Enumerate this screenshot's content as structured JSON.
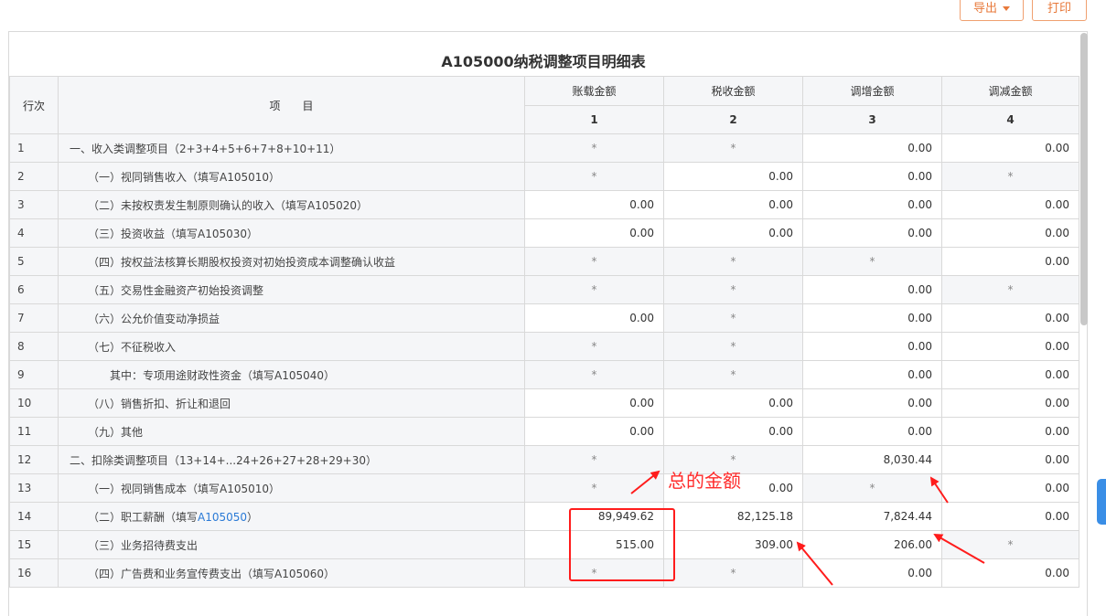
{
  "toolbar": {
    "export_label": "导出",
    "print_label": "打印"
  },
  "table_title": "A105000纳税调整项目明细表",
  "headers": {
    "row_no": "行次",
    "item": "项　　目",
    "col1": "账载金额",
    "col2": "税收金额",
    "col3": "调增金额",
    "col4": "调减金额",
    "n1": "1",
    "n2": "2",
    "n3": "3",
    "n4": "4"
  },
  "rows": [
    {
      "no": "1",
      "item": "一、收入类调整项目（2+3+4+5+6+7+8+10+11）",
      "c1": "*",
      "c2": "*",
      "c3": "0.00",
      "c4": "0.00"
    },
    {
      "no": "2",
      "item": "（一）视同销售收入（填写A105010）",
      "c1": "*",
      "c2": "0.00",
      "c3": "0.00",
      "c4": "*"
    },
    {
      "no": "3",
      "item": "（二）未按权责发生制原则确认的收入（填写A105020）",
      "c1": "0.00",
      "c2": "0.00",
      "c3": "0.00",
      "c4": "0.00"
    },
    {
      "no": "4",
      "item": "（三）投资收益（填写A105030）",
      "c1": "0.00",
      "c2": "0.00",
      "c3": "0.00",
      "c4": "0.00"
    },
    {
      "no": "5",
      "item": "（四）按权益法核算长期股权投资对初始投资成本调整确认收益",
      "c1": "*",
      "c2": "*",
      "c3": "*",
      "c4": "0.00"
    },
    {
      "no": "6",
      "item": "（五）交易性金融资产初始投资调整",
      "c1": "*",
      "c2": "*",
      "c3": "0.00",
      "c4": "*"
    },
    {
      "no": "7",
      "item": "（六）公允价值变动净损益",
      "c1": "0.00",
      "c2": "*",
      "c3": "0.00",
      "c4": "0.00"
    },
    {
      "no": "8",
      "item": "（七）不征税收入",
      "c1": "*",
      "c2": "*",
      "c3": "0.00",
      "c4": "0.00"
    },
    {
      "no": "9",
      "item": "其中：专项用途财政性资金（填写A105040）",
      "c1": "*",
      "c2": "*",
      "c3": "0.00",
      "c4": "0.00"
    },
    {
      "no": "10",
      "item": "（八）销售折扣、折让和退回",
      "c1": "0.00",
      "c2": "0.00",
      "c3": "0.00",
      "c4": "0.00"
    },
    {
      "no": "11",
      "item": "（九）其他",
      "c1": "0.00",
      "c2": "0.00",
      "c3": "0.00",
      "c4": "0.00"
    },
    {
      "no": "12",
      "item": "二、扣除类调整项目（13+14+...24+26+27+28+29+30）",
      "c1": "*",
      "c2": "*",
      "c3": "8,030.44",
      "c4": "0.00"
    },
    {
      "no": "13",
      "item": "（一）视同销售成本（填写A105010）",
      "c1": "*",
      "c2": "0.00",
      "c3": "*",
      "c4": "0.00"
    },
    {
      "no": "14",
      "item_prefix": "（二）职工薪酬（填写",
      "item_link": "A105050",
      "item_suffix": "）",
      "c1": "89,949.62",
      "c2": "82,125.18",
      "c3": "7,824.44",
      "c4": "0.00"
    },
    {
      "no": "15",
      "item": "（三）业务招待费支出",
      "c1": "515.00",
      "c2": "309.00",
      "c3": "206.00",
      "c4": "*"
    },
    {
      "no": "16",
      "item": "（四）广告费和业务宣传费支出（填写A105060）",
      "c1": "*",
      "c2": "*",
      "c3": "0.00",
      "c4": "0.00"
    }
  ],
  "annotation": {
    "text": "总的金额",
    "color": "#ff2a2a"
  }
}
